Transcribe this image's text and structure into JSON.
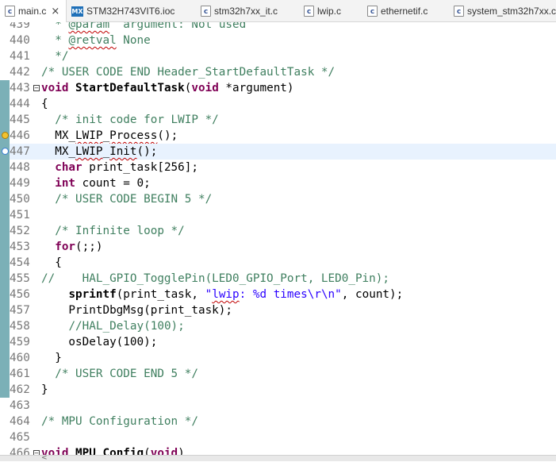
{
  "tabs": [
    {
      "label": "main.c",
      "icon": "c-file-icon",
      "active": true
    },
    {
      "label": "STM32H743VIT6.ioc",
      "icon": "mx-file-icon"
    },
    {
      "label": "stm32h7xx_it.c",
      "icon": "c-file-icon"
    },
    {
      "label": "lwip.c",
      "icon": "c-file-icon"
    },
    {
      "label": "ethernetif.c",
      "icon": "c-file-icon"
    },
    {
      "label": "system_stm32h7xx.c",
      "icon": "c-file-icon"
    }
  ],
  "close_glyph": "×",
  "editor": {
    "lines": [
      {
        "num": "439",
        "text": "  * @param  argument: Not used"
      },
      {
        "num": "440",
        "text": "  * @retval None"
      },
      {
        "num": "441",
        "text": "  */"
      },
      {
        "num": "442",
        "text": "/* USER CODE END Header_StartDefaultTask */"
      },
      {
        "num": "443",
        "text": "void StartDefaultTask(void *argument)"
      },
      {
        "num": "444",
        "text": "{"
      },
      {
        "num": "445",
        "text": "  /* init code for LWIP */"
      },
      {
        "num": "446",
        "text": "  MX_LWIP_Process();"
      },
      {
        "num": "447",
        "text": "  MX_LWIP_Init();"
      },
      {
        "num": "448",
        "text": "  char print_task[256];"
      },
      {
        "num": "449",
        "text": "  int count = 0;"
      },
      {
        "num": "450",
        "text": "  /* USER CODE BEGIN 5 */"
      },
      {
        "num": "451",
        "text": ""
      },
      {
        "num": "452",
        "text": "  /* Infinite loop */"
      },
      {
        "num": "453",
        "text": "  for(;;)"
      },
      {
        "num": "454",
        "text": "  {"
      },
      {
        "num": "455",
        "text": "//    HAL_GPIO_TogglePin(LED0_GPIO_Port, LED0_Pin);"
      },
      {
        "num": "456",
        "text": "    sprintf(print_task, \"lwip: %d times\\r\\n\", count);"
      },
      {
        "num": "457",
        "text": "    PrintDbgMsg(print_task);"
      },
      {
        "num": "458",
        "text": "    //HAL_Delay(100);"
      },
      {
        "num": "459",
        "text": "    osDelay(100);"
      },
      {
        "num": "460",
        "text": "  }"
      },
      {
        "num": "461",
        "text": "  /* USER CODE END 5 */"
      },
      {
        "num": "462",
        "text": "}"
      },
      {
        "num": "463",
        "text": ""
      },
      {
        "num": "464",
        "text": "/* MPU Configuration */"
      },
      {
        "num": "465",
        "text": ""
      },
      {
        "num": "466",
        "text": "void MPU_Config(void)"
      }
    ]
  },
  "colors": {
    "keyword": "#7f0055",
    "comment": "#3f7f5f",
    "string": "#2a00ff",
    "line_number": "#787878",
    "current_line": "#e8f2fe",
    "change_bar": "#7bb0b7"
  },
  "scroll_left_arrow": "<"
}
